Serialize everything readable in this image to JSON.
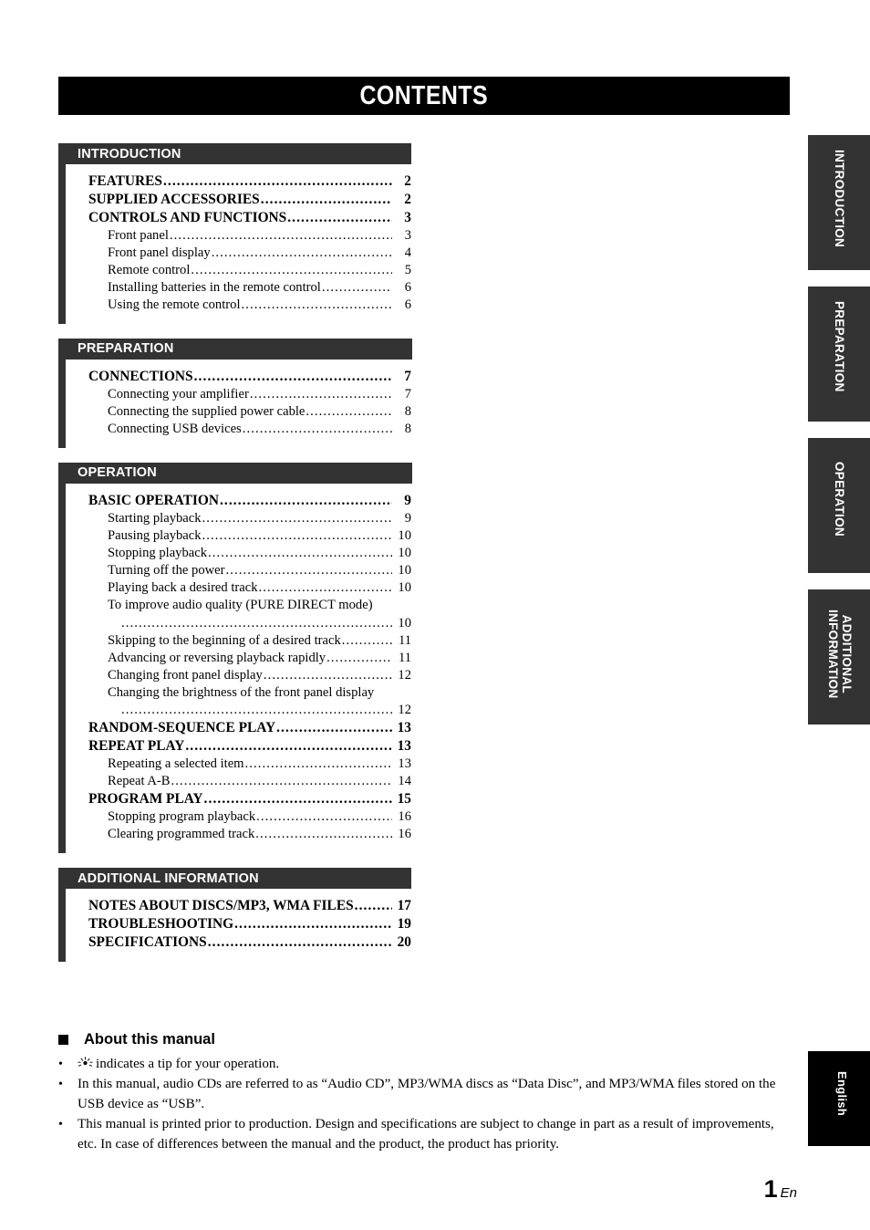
{
  "page": {
    "title": "CONTENTS",
    "number": "1",
    "number_suffix": "En"
  },
  "sections": [
    {
      "id": "introduction",
      "header": "INTRODUCTION",
      "entries": [
        {
          "level": 1,
          "text": "FEATURES",
          "page": "2",
          "wrapped": false
        },
        {
          "level": 1,
          "text": "SUPPLIED ACCESSORIES",
          "page": "2",
          "wrapped": false
        },
        {
          "level": 1,
          "text": "CONTROLS AND FUNCTIONS",
          "page": "3",
          "wrapped": false
        },
        {
          "level": 2,
          "text": "Front panel",
          "page": "3",
          "wrapped": false
        },
        {
          "level": 2,
          "text": "Front panel display",
          "page": "4",
          "wrapped": false
        },
        {
          "level": 2,
          "text": "Remote control",
          "page": "5",
          "wrapped": false
        },
        {
          "level": 2,
          "text": "Installing batteries in the remote control",
          "page": "6",
          "wrapped": false
        },
        {
          "level": 2,
          "text": "Using the remote control",
          "page": "6",
          "wrapped": false
        }
      ]
    },
    {
      "id": "preparation",
      "header": "PREPARATION",
      "entries": [
        {
          "level": 1,
          "text": "CONNECTIONS",
          "page": "7",
          "wrapped": false
        },
        {
          "level": 2,
          "text": "Connecting your amplifier",
          "page": "7",
          "wrapped": false
        },
        {
          "level": 2,
          "text": "Connecting the supplied power cable",
          "page": "8",
          "wrapped": false
        },
        {
          "level": 2,
          "text": "Connecting USB devices",
          "page": "8",
          "wrapped": false
        }
      ]
    },
    {
      "id": "operation",
      "header": "OPERATION",
      "entries": [
        {
          "level": 1,
          "text": "BASIC OPERATION",
          "page": "9",
          "wrapped": false
        },
        {
          "level": 2,
          "text": "Starting playback",
          "page": "9",
          "wrapped": false
        },
        {
          "level": 2,
          "text": "Pausing playback",
          "page": "10",
          "wrapped": false
        },
        {
          "level": 2,
          "text": "Stopping playback",
          "page": "10",
          "wrapped": false
        },
        {
          "level": 2,
          "text": "Turning off the power",
          "page": "10",
          "wrapped": false
        },
        {
          "level": 2,
          "text": "Playing back a desired track",
          "page": "10",
          "wrapped": false
        },
        {
          "level": 2,
          "text": "To improve audio quality (PURE DIRECT mode)",
          "page": "10",
          "wrapped": true
        },
        {
          "level": 2,
          "text": "Skipping to the beginning of a desired track",
          "page": "11",
          "wrapped": false
        },
        {
          "level": 2,
          "text": "Advancing or reversing playback rapidly",
          "page": "11",
          "wrapped": false
        },
        {
          "level": 2,
          "text": "Changing front panel display",
          "page": "12",
          "wrapped": false
        },
        {
          "level": 2,
          "text": "Changing the brightness of the front panel display",
          "page": "12",
          "wrapped": true
        },
        {
          "level": 1,
          "text": "RANDOM-SEQUENCE PLAY",
          "page": "13",
          "wrapped": false
        },
        {
          "level": 1,
          "text": "REPEAT PLAY",
          "page": "13",
          "wrapped": false
        },
        {
          "level": 2,
          "text": "Repeating a selected item",
          "page": "13",
          "wrapped": false
        },
        {
          "level": 2,
          "text": "Repeat A-B",
          "page": "14",
          "wrapped": false
        },
        {
          "level": 1,
          "text": "PROGRAM PLAY",
          "page": "15",
          "wrapped": false
        },
        {
          "level": 2,
          "text": "Stopping program playback",
          "page": "16",
          "wrapped": false
        },
        {
          "level": 2,
          "text": "Clearing programmed track",
          "page": "16",
          "wrapped": false
        }
      ]
    },
    {
      "id": "additional-information",
      "header": "ADDITIONAL INFORMATION",
      "entries": [
        {
          "level": 1,
          "text": "NOTES ABOUT DISCS/MP3, WMA FILES",
          "page": "17",
          "wrapped": false
        },
        {
          "level": 1,
          "text": "TROUBLESHOOTING",
          "page": "19",
          "wrapped": false
        },
        {
          "level": 1,
          "text": "SPECIFICATIONS",
          "page": "20",
          "wrapped": false
        }
      ]
    }
  ],
  "side_tabs": [
    {
      "id": "introduction",
      "label": "INTRODUCTION"
    },
    {
      "id": "preparation",
      "label": "PREPARATION"
    },
    {
      "id": "operation",
      "label": "OPERATION"
    },
    {
      "id": "additional-information",
      "label_line1": "ADDITIONAL",
      "label_line2": "INFORMATION"
    },
    {
      "id": "language",
      "label": "English"
    }
  ],
  "about": {
    "heading": "About this manual",
    "bullets": [
      {
        "icon": "tip-sun-icon",
        "text": "indicates a tip for your operation."
      },
      {
        "icon": null,
        "text": "In this manual, audio CDs are referred to as “Audio CD”, MP3/WMA discs as “Data Disc”, and MP3/WMA files stored on the USB device as “USB”."
      },
      {
        "icon": null,
        "text": "This manual is printed prior to production. Design and specifications are subject to change in part as a result of improvements, etc. In case of differences between the manual and the product, the product has priority."
      }
    ]
  },
  "colors": {
    "title_bar": "#000000",
    "section_header": "#333333",
    "language_tab": "#000000",
    "text": "#000000"
  }
}
